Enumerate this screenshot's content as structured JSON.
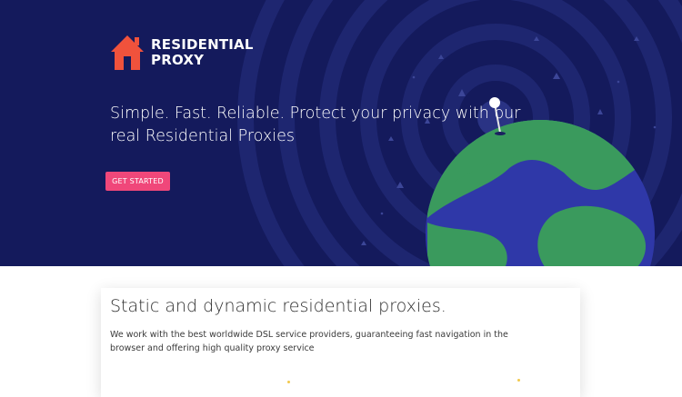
{
  "brand": {
    "line1": "RESIDENTIAL",
    "line2": "PROXY",
    "logo_icon": "house-icon",
    "logo_color": "#f0523c"
  },
  "hero": {
    "headline": "Simple. Fast. Reliable. Protect your privacy with our real Residential Proxies",
    "cta_label": "GET STARTED",
    "background_color": "#141a5c",
    "cta_color": "#f0477a"
  },
  "features": {
    "title": "Static and dynamic residential proxies.",
    "body": "We work with the best worldwide DSL service providers, guaranteeing fast navigation in the browser and offering high quality proxy service"
  },
  "colors": {
    "globe_land": "#3a9a5d",
    "globe_water": "#2f38a8",
    "pin": "#ffffff"
  }
}
